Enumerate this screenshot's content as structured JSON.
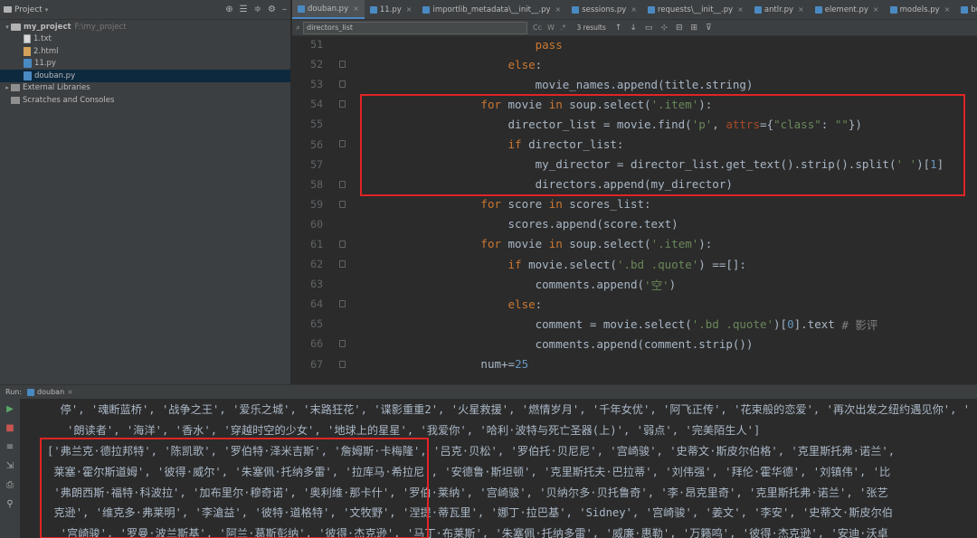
{
  "project": {
    "title": "Project",
    "tree": [
      {
        "level": 0,
        "arrow": "▾",
        "icon": "folder",
        "label": "my_project",
        "path": "F:\\my_project",
        "bold": true
      },
      {
        "level": 1,
        "arrow": "",
        "icon": "file",
        "label": "1.txt"
      },
      {
        "level": 1,
        "arrow": "",
        "icon": "html",
        "label": "2.html"
      },
      {
        "level": 1,
        "arrow": "",
        "icon": "py",
        "label": "11.py"
      },
      {
        "level": 1,
        "arrow": "",
        "icon": "py",
        "label": "douban.py",
        "selected": true
      },
      {
        "level": 0,
        "arrow": "▸",
        "icon": "lib",
        "label": "External Libraries"
      },
      {
        "level": 0,
        "arrow": "",
        "icon": "scratch",
        "label": "Scratches and Consoles"
      }
    ]
  },
  "tabs": [
    {
      "label": "douban.py",
      "active": true
    },
    {
      "label": "11.py"
    },
    {
      "label": "importlib_metadata\\__init__.py"
    },
    {
      "label": "sessions.py"
    },
    {
      "label": "requests\\__init__.py"
    },
    {
      "label": "antlr.py"
    },
    {
      "label": "element.py"
    },
    {
      "label": "models.py"
    },
    {
      "label": "builtins.py"
    }
  ],
  "find": {
    "value": "directors_list",
    "results": "3 results",
    "opt_case": "Cc",
    "opt_word": "W"
  },
  "code": [
    {
      "n": "51",
      "indent": "                        ",
      "tokens": [
        {
          "t": "pass",
          "c": "kw"
        }
      ]
    },
    {
      "n": "52",
      "indent": "                    ",
      "tokens": [
        {
          "t": "else",
          "c": "kw"
        },
        {
          "t": ":",
          "c": "src"
        }
      ],
      "fold": true
    },
    {
      "n": "53",
      "indent": "                        ",
      "tokens": [
        {
          "t": "movie_names.append(title.string)",
          "c": "src"
        }
      ],
      "fold": true
    },
    {
      "n": "54",
      "indent": "                ",
      "tokens": [
        {
          "t": "for",
          "c": "kw"
        },
        {
          "t": " movie ",
          "c": "src"
        },
        {
          "t": "in",
          "c": "kw"
        },
        {
          "t": " soup.select(",
          "c": "src"
        },
        {
          "t": "'.item'",
          "c": "str"
        },
        {
          "t": "):",
          "c": "src"
        }
      ],
      "fold": true
    },
    {
      "n": "55",
      "indent": "                    ",
      "tokens": [
        {
          "t": "director_list = movie.find(",
          "c": "src"
        },
        {
          "t": "'p'",
          "c": "str"
        },
        {
          "t": ", ",
          "c": "src"
        },
        {
          "t": "attrs",
          "c": "kwarg"
        },
        {
          "t": "={",
          "c": "src"
        },
        {
          "t": "\"class\"",
          "c": "str"
        },
        {
          "t": ": ",
          "c": "src"
        },
        {
          "t": "\"\"",
          "c": "str"
        },
        {
          "t": "})",
          "c": "src"
        }
      ]
    },
    {
      "n": "56",
      "indent": "                    ",
      "tokens": [
        {
          "t": "if",
          "c": "kw"
        },
        {
          "t": " director_list:",
          "c": "src"
        }
      ],
      "fold": true
    },
    {
      "n": "57",
      "indent": "                        ",
      "tokens": [
        {
          "t": "my_director = director_list.get_text().strip().split(",
          "c": "src"
        },
        {
          "t": "' '",
          "c": "str"
        },
        {
          "t": ")[",
          "c": "src"
        },
        {
          "t": "1",
          "c": "num"
        },
        {
          "t": "]",
          "c": "src"
        }
      ]
    },
    {
      "n": "58",
      "indent": "                        ",
      "tokens": [
        {
          "t": "directors.append(my_director)",
          "c": "src"
        }
      ],
      "fold": true
    },
    {
      "n": "59",
      "indent": "                ",
      "tokens": [
        {
          "t": "for",
          "c": "kw"
        },
        {
          "t": " score ",
          "c": "src"
        },
        {
          "t": "in",
          "c": "kw"
        },
        {
          "t": " scores_list:",
          "c": "src"
        }
      ],
      "fold": true
    },
    {
      "n": "60",
      "indent": "                    ",
      "tokens": [
        {
          "t": "scores.append(score.text)",
          "c": "src"
        }
      ]
    },
    {
      "n": "61",
      "indent": "                ",
      "tokens": [
        {
          "t": "for",
          "c": "kw"
        },
        {
          "t": " movie ",
          "c": "src"
        },
        {
          "t": "in",
          "c": "kw"
        },
        {
          "t": " soup.select(",
          "c": "src"
        },
        {
          "t": "'.item'",
          "c": "str"
        },
        {
          "t": "):",
          "c": "src"
        }
      ],
      "fold": true
    },
    {
      "n": "62",
      "indent": "                    ",
      "tokens": [
        {
          "t": "if",
          "c": "kw"
        },
        {
          "t": " movie.select(",
          "c": "src"
        },
        {
          "t": "'.bd .quote'",
          "c": "str"
        },
        {
          "t": ") ==[]:",
          "c": "src"
        }
      ],
      "fold": true
    },
    {
      "n": "63",
      "indent": "                        ",
      "tokens": [
        {
          "t": "comments.append(",
          "c": "src"
        },
        {
          "t": "'空'",
          "c": "str"
        },
        {
          "t": ")",
          "c": "src"
        }
      ]
    },
    {
      "n": "64",
      "indent": "                    ",
      "tokens": [
        {
          "t": "else",
          "c": "kw"
        },
        {
          "t": ":",
          "c": "src"
        }
      ],
      "fold": true
    },
    {
      "n": "65",
      "indent": "                        ",
      "tokens": [
        {
          "t": "comment = movie.select(",
          "c": "src"
        },
        {
          "t": "'.bd .quote'",
          "c": "str"
        },
        {
          "t": ")[",
          "c": "src"
        },
        {
          "t": "0",
          "c": "num"
        },
        {
          "t": "].text ",
          "c": "src"
        },
        {
          "t": "# 影评",
          "c": "cmt"
        }
      ]
    },
    {
      "n": "66",
      "indent": "                        ",
      "tokens": [
        {
          "t": "comments.append(comment.strip())",
          "c": "src"
        }
      ],
      "fold": true
    },
    {
      "n": "67",
      "indent": "                ",
      "tokens": [
        {
          "t": "num+=",
          "c": "src"
        },
        {
          "t": "25",
          "c": "num"
        }
      ],
      "fold": true
    }
  ],
  "run": {
    "label": "Run:",
    "tab": "douban"
  },
  "console": [
    "  停', '魂断蓝桥', '战争之王', '爱乐之城', '末路狂花', '谍影重重2', '火星救援', '燃情岁月', '千年女优', '阿飞正传', '花束般的恋爱', '再次出发之纽约遇见你', '",
    "   '朗读者', '海洋', '香水', '穿越时空的少女', '地球上的星星', '我爱你', '哈利·波特与死亡圣器(上)', '弱点', '完美陌生人']",
    "['弗兰克·德拉邦特', '陈凯歌', '罗伯特·泽米吉斯', '詹姆斯·卡梅隆', '吕克·贝松', '罗伯托·贝尼尼', '宫崎骏', '史蒂文·斯皮尔伯格', '克里斯托弗·诺兰',",
    " 莱塞·霍尔斯道姆', '彼得·威尔', '朱塞佩·托纳多雷', '拉库马·希拉尼', '安德鲁·斯坦顿', '克里斯托夫·巴拉蒂', '刘伟强', '拜伦·霍华德', '刘镇伟', '比",
    " '弗朗西斯·福特·科波拉', '加布里尔·穆奇诺', '奥利维·那卡什', '罗伯·莱纳', '宫崎骏', '贝纳尔多·贝托鲁奇', '李·昂克里奇', '克里斯托弗·诺兰', '张艺",
    " 克逊', '维克多·弗莱明', '李滄益', '彼特·道格特', '文牧野', '涅提·蒂瓦里', '娜丁·拉巴基', 'Sidney', '宫崎骏', '姜文', '李安', '史蒂文·斯皮尔伯",
    "  '宫崎骏', '罗曼·波兰斯基', '阿兰·葛斯彭纳', '彼得·杰克逊', '马丁·布莱斯', '朱塞佩·托纳多雷', '威廉·惠勒', '万籁鸣', '彼得·杰克逊', '安迪·沃卓"
  ]
}
